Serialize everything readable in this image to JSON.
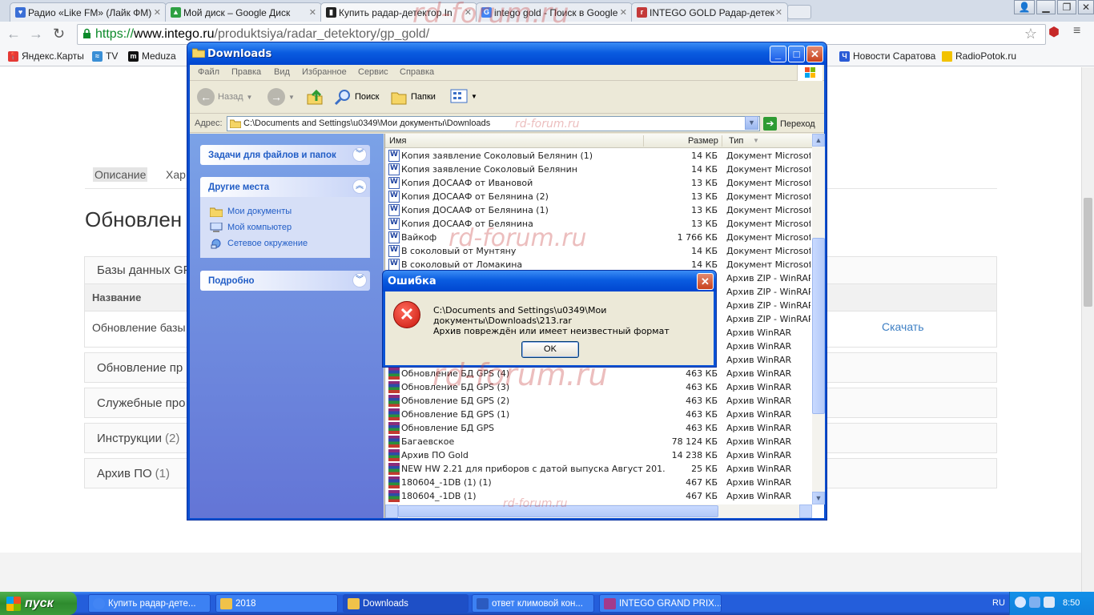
{
  "browser": {
    "tabs": [
      {
        "title": "Радио «Like FM» (Лайк ФМ)",
        "favicon_color": "#3b6fd6",
        "active": false
      },
      {
        "title": "Мой диск – Google Диск",
        "favicon_color": "#2ea043",
        "active": false
      },
      {
        "title": "Купить радар-детектор In",
        "favicon_color": "#222222",
        "active": true
      },
      {
        "title": "intego gold - Поиск в Google",
        "favicon_color": "#4285f4",
        "active": false
      },
      {
        "title": "INTEGO GOLD Радар-детек",
        "favicon_color": "#c43a3a",
        "active": false
      }
    ],
    "url": {
      "scheme": "https://",
      "host": "www.intego.ru",
      "path": "/produktsiya/radar_detektory/gp_gold/"
    },
    "bookmarks": [
      {
        "label": "Яндекс.Карты",
        "icon": "map-pin-icon",
        "color": "#e53935"
      },
      {
        "label": "TV",
        "icon": "tv-icon",
        "color": "#3a8fd6"
      },
      {
        "label": "Meduza",
        "icon": "meduza-icon",
        "color": "#111111"
      },
      {
        "label": "Новости Саратова",
        "icon": "news-icon",
        "color": "#2a5bd6"
      },
      {
        "label": "RadioPotok.ru",
        "icon": "folder-icon",
        "color": "#f2c200"
      }
    ]
  },
  "webpage": {
    "tabs": [
      "Описание",
      "Хар"
    ],
    "heading": "Обновлен",
    "open_section": {
      "title": "Базы данных GP",
      "column_header": "Название",
      "row_label": "Обновление базы",
      "download_label": "Скачать"
    },
    "sections": [
      {
        "title": "Обновление пр",
        "count": ""
      },
      {
        "title": "Служебные про",
        "count": ""
      },
      {
        "title": "Инструкции",
        "count": "(2)"
      },
      {
        "title": "Архив ПО",
        "count": "(1)"
      }
    ]
  },
  "explorer": {
    "title": "Downloads",
    "menu": [
      "Файл",
      "Правка",
      "Вид",
      "Избранное",
      "Сервис",
      "Справка"
    ],
    "toolbar": {
      "back": "Назад",
      "search": "Поиск",
      "folders": "Папки"
    },
    "address_label": "Адрес:",
    "address": "C:\\Documents and Settings\\u0349\\Мои документы\\Downloads",
    "go": "Переход",
    "tasks_panel": "Задачи для файлов и папок",
    "places_panel": "Другие места",
    "places": [
      "Мои документы",
      "Мой компьютер",
      "Сетевое окружение"
    ],
    "details_panel": "Подробно",
    "columns": {
      "name": "Имя",
      "size": "Размер",
      "type": "Тип"
    },
    "files": [
      {
        "name": "Копия заявление Соколовый Белянин (1)",
        "size": "14 КБ",
        "type": "Документ Microsof...",
        "kind": "doc"
      },
      {
        "name": "Копия заявление Соколовый Белянин",
        "size": "14 КБ",
        "type": "Документ Microsof...",
        "kind": "doc"
      },
      {
        "name": "Копия ДОСААФ от Ивановой",
        "size": "13 КБ",
        "type": "Документ Microsof...",
        "kind": "doc"
      },
      {
        "name": "Копия ДОСААФ от Белянина (2)",
        "size": "13 КБ",
        "type": "Документ Microsof...",
        "kind": "doc"
      },
      {
        "name": "Копия ДОСААФ от Белянина (1)",
        "size": "13 КБ",
        "type": "Документ Microsof...",
        "kind": "doc"
      },
      {
        "name": "Копия ДОСААФ от Белянина",
        "size": "13 КБ",
        "type": "Документ Microsof...",
        "kind": "doc"
      },
      {
        "name": "Вайкоф",
        "size": "1 766 КБ",
        "type": "Документ Microsof...",
        "kind": "doc"
      },
      {
        "name": "В соколовый от Мунтяну",
        "size": "14 КБ",
        "type": "Документ Microsof...",
        "kind": "doc"
      },
      {
        "name": "В соколовый от Ломакина",
        "size": "14 КБ",
        "type": "Документ Microsof...",
        "kind": "doc"
      },
      {
        "name": "",
        "size": "",
        "type": "Архив ZIP - WinRAR",
        "kind": "rar"
      },
      {
        "name": "",
        "size": "",
        "type": "Архив ZIP - WinRAR",
        "kind": "rar"
      },
      {
        "name": "",
        "size": "",
        "type": "Архив ZIP - WinRAR",
        "kind": "rar"
      },
      {
        "name": "",
        "size": "",
        "type": "Архив ZIP - WinRAR",
        "kind": "rar"
      },
      {
        "name": "",
        "size": "",
        "type": "Архив WinRAR",
        "kind": "rar"
      },
      {
        "name": "",
        "size": "",
        "type": "Архив WinRAR",
        "kind": "rar"
      },
      {
        "name": "",
        "size": "",
        "type": "Архив WinRAR",
        "kind": "rar"
      },
      {
        "name": "Обновление БД GPS (4)",
        "size": "463 КБ",
        "type": "Архив WinRAR",
        "kind": "rar"
      },
      {
        "name": "Обновление БД GPS (3)",
        "size": "463 КБ",
        "type": "Архив WinRAR",
        "kind": "rar"
      },
      {
        "name": "Обновление БД GPS (2)",
        "size": "463 КБ",
        "type": "Архив WinRAR",
        "kind": "rar"
      },
      {
        "name": "Обновление БД GPS (1)",
        "size": "463 КБ",
        "type": "Архив WinRAR",
        "kind": "rar"
      },
      {
        "name": "Обновление БД GPS",
        "size": "463 КБ",
        "type": "Архив WinRAR",
        "kind": "rar"
      },
      {
        "name": "Багаевское",
        "size": "78 124 КБ",
        "type": "Архив WinRAR",
        "kind": "rar"
      },
      {
        "name": "Архив ПО Gold",
        "size": "14 238 КБ",
        "type": "Архив WinRAR",
        "kind": "rar"
      },
      {
        "name": "NEW HW 2.21 для приборов с датой выпуска Август 201...",
        "size": "25 КБ",
        "type": "Архив WinRAR",
        "kind": "rar"
      },
      {
        "name": "180604_-1DB (1) (1)",
        "size": "467 КБ",
        "type": "Архив WinRAR",
        "kind": "rar"
      },
      {
        "name": "180604_-1DB (1)",
        "size": "467 КБ",
        "type": "Архив WinRAR",
        "kind": "rar"
      }
    ]
  },
  "error_dialog": {
    "title": "Ошибка",
    "path": "C:\\Documents and Settings\\u0349\\Мои документы\\Downloads\\213.rar",
    "message": "Архив повреждён или имеет неизвестный формат",
    "ok": "OK"
  },
  "watermark": "rd-forum.ru",
  "taskbar": {
    "start": "пуск",
    "tasks": [
      {
        "label": "Купить радар-дете...",
        "icon_color": "#4285f4"
      },
      {
        "label": "2018",
        "icon_color": "#f0c24a"
      },
      {
        "label": "Downloads",
        "icon_color": "#f0c24a"
      },
      {
        "label": "ответ климовой кон...",
        "icon_color": "#2b5bc0"
      },
      {
        "label": "INTEGO GRAND PRIX...",
        "icon_color": "#a33a8c"
      }
    ],
    "lang": "RU",
    "clock": "8:50"
  }
}
